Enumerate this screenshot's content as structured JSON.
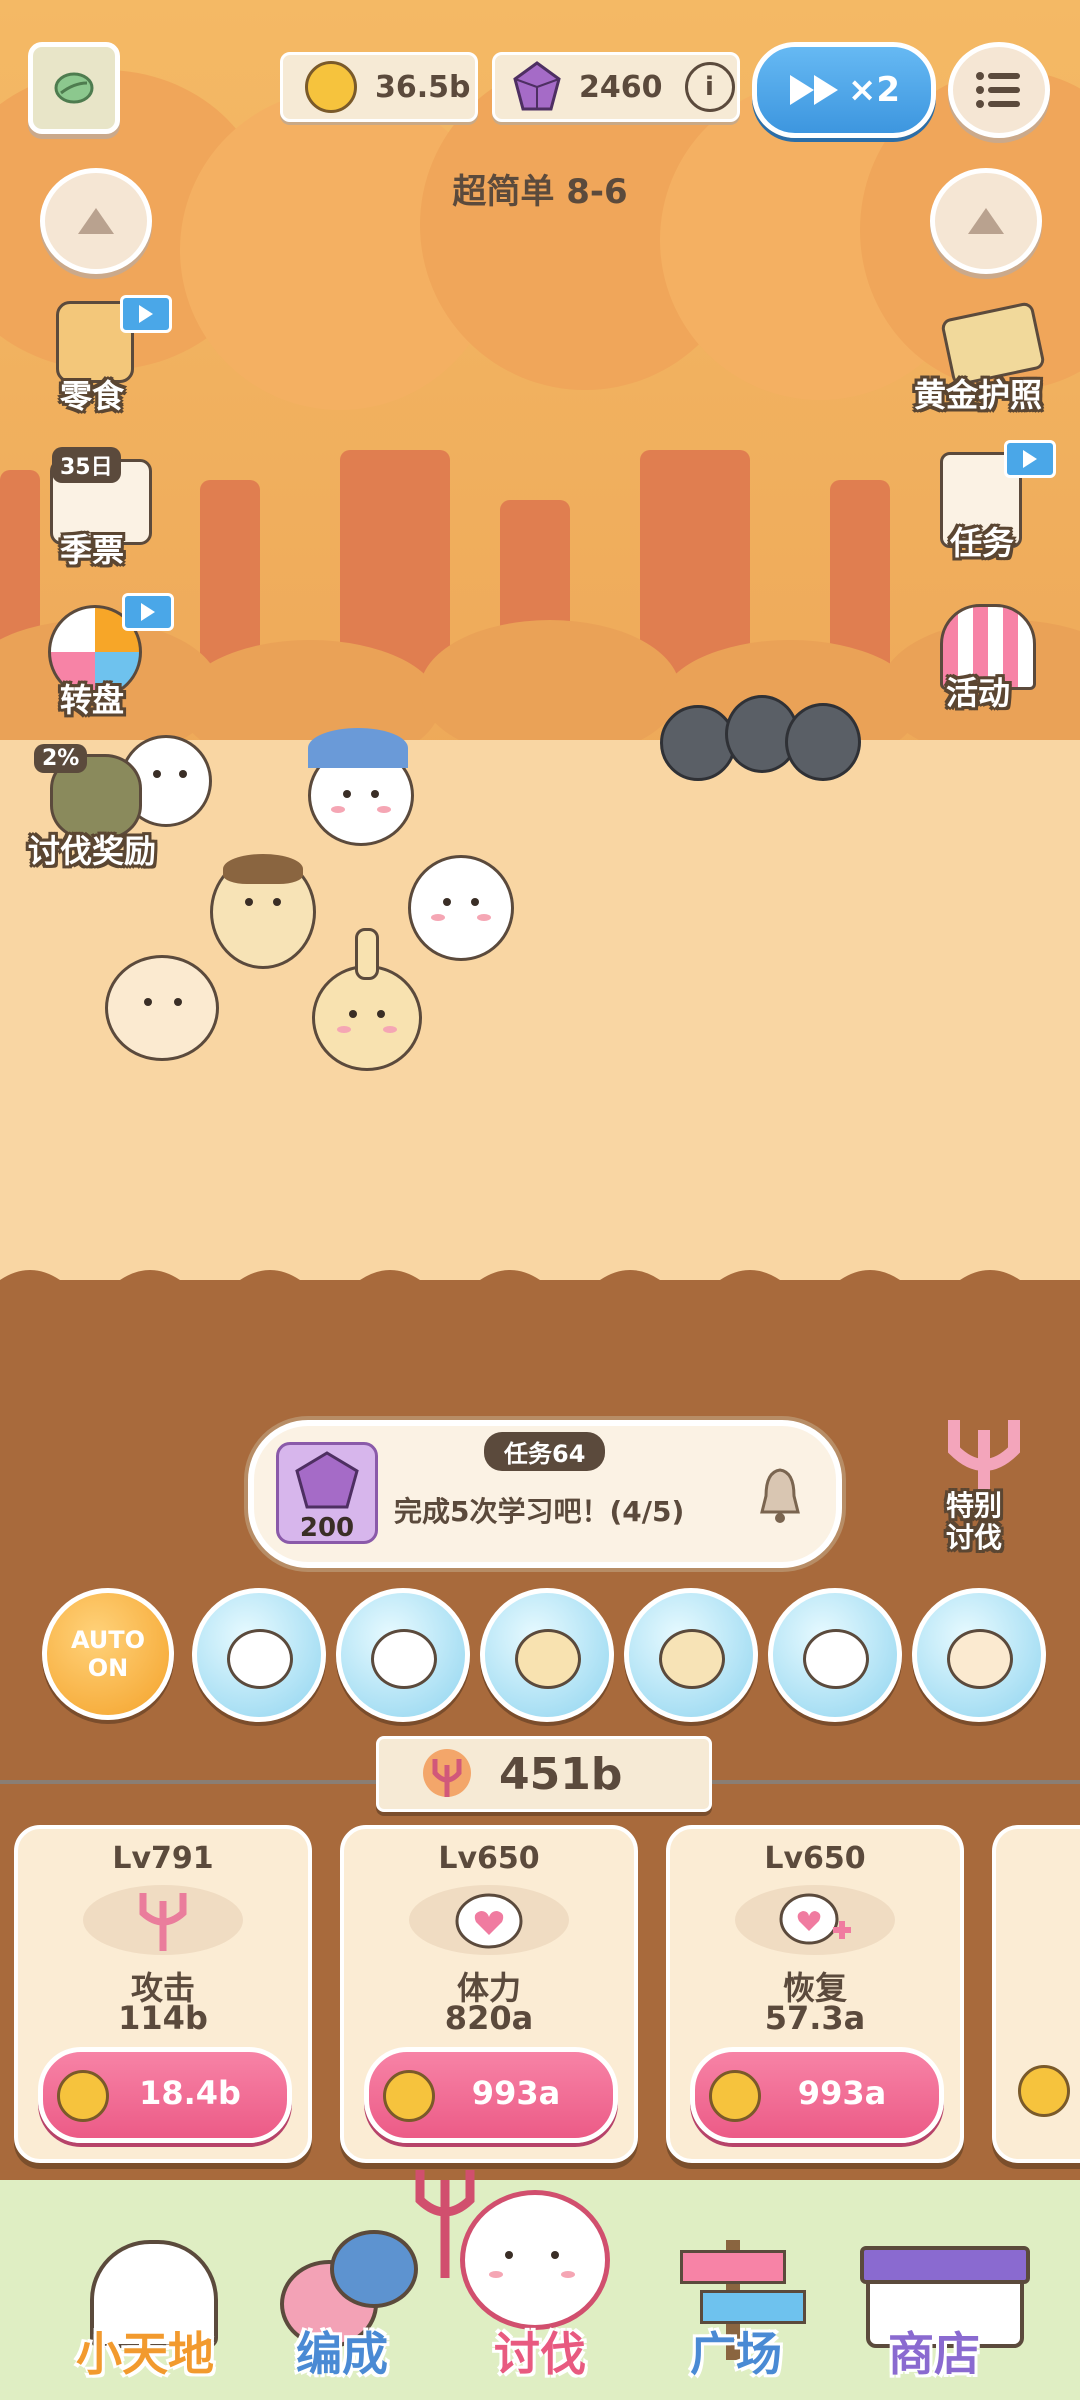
{
  "top_bar": {
    "gold_amount": "36.5b",
    "gem_amount": "2460",
    "speed_label": "×2"
  },
  "stage": {
    "title": "超简单 8-6"
  },
  "left_menu": {
    "snacks": "零食",
    "season_pass_badge": "35日",
    "season_pass": "季票",
    "wheel": "转盘",
    "reward_percent": "2%",
    "subjugation_reward": "讨伐奖励"
  },
  "right_menu": {
    "gold_passport": "黄金护照",
    "tasks": "任务",
    "events": "活动"
  },
  "quest": {
    "tag": "任务64",
    "reward_count": "200",
    "text": "完成5次学习吧！(4/5)"
  },
  "special_subjugation": "特别\n讨伐",
  "auto_button": {
    "line1": "AUTO",
    "line2": "ON"
  },
  "power_total": "451b",
  "upgrade_cards": [
    {
      "level": "Lv791",
      "name": "攻击",
      "value": "114b",
      "price": "18.4b",
      "icon": "trident-icon"
    },
    {
      "level": "Lv650",
      "name": "体力",
      "value": "820a",
      "price": "993a",
      "icon": "heart-icon"
    },
    {
      "level": "Lv650",
      "name": "恢复",
      "value": "57.3a",
      "price": "993a",
      "icon": "heal-icon"
    }
  ],
  "bottom_nav": {
    "home": "小天地",
    "formation": "编成",
    "subjugation": "讨伐",
    "plaza": "广场",
    "shop": "商店"
  },
  "colors": {
    "accent_blue": "#4aa7e8",
    "buy_pink": "#ec5b87",
    "dirt_brown": "#a86a3c",
    "auto_orange": "#f7a628"
  }
}
